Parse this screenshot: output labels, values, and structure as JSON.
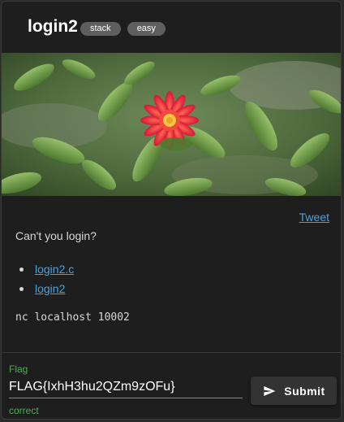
{
  "challenge": {
    "title": "login2",
    "tags": [
      "stack",
      "easy"
    ]
  },
  "tweet_label": "Tweet",
  "description": "Can't you login?",
  "files": [
    "login2.c",
    "login2"
  ],
  "command": "nc localhost 10002",
  "form": {
    "label": "Flag",
    "value": "FLAG{IxhH3hu2QZm9zOFu}",
    "status": "correct",
    "submit_label": "Submit",
    "submit_icon": "send-icon"
  },
  "colors": {
    "accent_success": "#4caf50",
    "link": "#4aa3df",
    "card_bg": "#1e1e1e"
  },
  "image": {
    "subject": "red flower among green plants"
  }
}
